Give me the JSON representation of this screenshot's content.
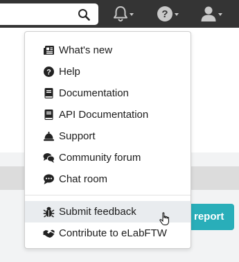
{
  "topbar": {
    "search_icon": "search-icon",
    "notifications_icon": "bell-icon",
    "help_icon": "question-circle-icon",
    "user_icon": "user-icon",
    "bg_color": "#343434"
  },
  "help_menu": {
    "items": [
      {
        "label": "What's new",
        "icon": "newspaper-icon"
      },
      {
        "label": "Help",
        "icon": "question-circle-icon"
      },
      {
        "label": "Documentation",
        "icon": "book-icon"
      },
      {
        "label": "API Documentation",
        "icon": "book-icon"
      },
      {
        "label": "Support",
        "icon": "concierge-bell-icon"
      },
      {
        "label": "Community forum",
        "icon": "comments-icon"
      },
      {
        "label": "Chat room",
        "icon": "comment-dots-icon"
      }
    ],
    "secondary_items": [
      {
        "label": "Submit feedback",
        "icon": "bug-icon",
        "hovered": true
      },
      {
        "label": "Contribute to eLabFTW",
        "icon": "handshake-icon"
      }
    ]
  },
  "page": {
    "report_button_label": "report",
    "accent_color": "#29aeb9"
  }
}
